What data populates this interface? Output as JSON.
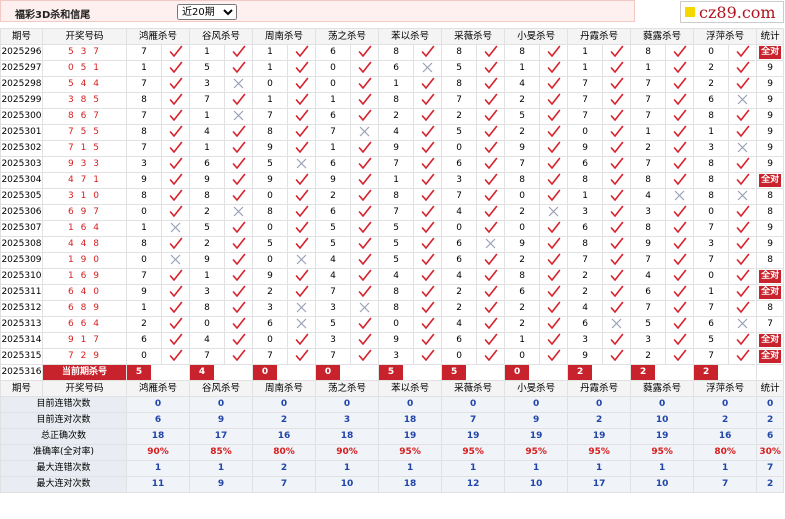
{
  "header": {
    "title": "福彩3D杀和信尾",
    "select_value": "近20期",
    "site": "cz89.com"
  },
  "columns": {
    "period": "期号",
    "code": "开奖号码",
    "stat": "统计",
    "experts": [
      "鸿雁杀号",
      "谷风杀号",
      "周南杀号",
      "荡之杀号",
      "苯以杀号",
      "采薇杀号",
      "小旻杀号",
      "丹霞杀号",
      "蕤露杀号",
      "浮萍杀号"
    ]
  },
  "labels": {
    "all_right": "全对",
    "current": "当前期杀号"
  },
  "rows": [
    {
      "p": "2025296",
      "c": "537",
      "v": [
        [
          7,
          1
        ],
        [
          1,
          1
        ],
        [
          1,
          1
        ],
        [
          6,
          1
        ],
        [
          8,
          1
        ],
        [
          8,
          1
        ],
        [
          8,
          1
        ],
        [
          1,
          1
        ],
        [
          8,
          1
        ],
        [
          0,
          1
        ]
      ],
      "s": "全对"
    },
    {
      "p": "2025297",
      "c": "051",
      "v": [
        [
          1,
          1
        ],
        [
          5,
          1
        ],
        [
          1,
          1
        ],
        [
          0,
          1
        ],
        [
          6,
          0
        ],
        [
          5,
          1
        ],
        [
          1,
          1
        ],
        [
          1,
          1
        ],
        [
          1,
          1
        ],
        [
          2,
          1
        ]
      ],
      "s": "9"
    },
    {
      "p": "2025298",
      "c": "544",
      "v": [
        [
          7,
          1
        ],
        [
          3,
          0
        ],
        [
          0,
          1
        ],
        [
          0,
          1
        ],
        [
          1,
          1
        ],
        [
          8,
          1
        ],
        [
          4,
          1
        ],
        [
          7,
          1
        ],
        [
          7,
          1
        ],
        [
          2,
          1
        ]
      ],
      "s": "9"
    },
    {
      "p": "2025299",
      "c": "385",
      "v": [
        [
          8,
          1
        ],
        [
          7,
          1
        ],
        [
          1,
          1
        ],
        [
          1,
          1
        ],
        [
          8,
          1
        ],
        [
          7,
          1
        ],
        [
          2,
          1
        ],
        [
          7,
          1
        ],
        [
          7,
          1
        ],
        [
          6,
          0
        ]
      ],
      "s": "9"
    },
    {
      "p": "2025300",
      "c": "867",
      "v": [
        [
          7,
          1
        ],
        [
          1,
          0
        ],
        [
          7,
          1
        ],
        [
          6,
          1
        ],
        [
          2,
          1
        ],
        [
          2,
          1
        ],
        [
          5,
          1
        ],
        [
          7,
          1
        ],
        [
          7,
          1
        ],
        [
          8,
          1
        ]
      ],
      "s": "9"
    },
    {
      "p": "2025301",
      "c": "755",
      "v": [
        [
          8,
          1
        ],
        [
          4,
          1
        ],
        [
          8,
          1
        ],
        [
          7,
          0
        ],
        [
          4,
          1
        ],
        [
          5,
          1
        ],
        [
          2,
          1
        ],
        [
          0,
          1
        ],
        [
          1,
          1
        ],
        [
          1,
          1
        ]
      ],
      "s": "9"
    },
    {
      "p": "2025302",
      "c": "715",
      "v": [
        [
          7,
          1
        ],
        [
          1,
          1
        ],
        [
          9,
          1
        ],
        [
          1,
          1
        ],
        [
          9,
          1
        ],
        [
          0,
          1
        ],
        [
          9,
          1
        ],
        [
          9,
          1
        ],
        [
          2,
          1
        ],
        [
          3,
          0
        ]
      ],
      "s": "9"
    },
    {
      "p": "2025303",
      "c": "933",
      "v": [
        [
          3,
          1
        ],
        [
          6,
          1
        ],
        [
          5,
          0
        ],
        [
          6,
          1
        ],
        [
          7,
          1
        ],
        [
          6,
          1
        ],
        [
          7,
          1
        ],
        [
          6,
          1
        ],
        [
          7,
          1
        ],
        [
          8,
          1
        ]
      ],
      "s": "9"
    },
    {
      "p": "2025304",
      "c": "471",
      "v": [
        [
          9,
          1
        ],
        [
          9,
          1
        ],
        [
          9,
          1
        ],
        [
          9,
          1
        ],
        [
          1,
          1
        ],
        [
          3,
          1
        ],
        [
          8,
          1
        ],
        [
          8,
          1
        ],
        [
          8,
          1
        ],
        [
          8,
          1
        ]
      ],
      "s": "全对"
    },
    {
      "p": "2025305",
      "c": "310",
      "v": [
        [
          8,
          1
        ],
        [
          8,
          1
        ],
        [
          0,
          1
        ],
        [
          2,
          1
        ],
        [
          8,
          1
        ],
        [
          7,
          1
        ],
        [
          0,
          1
        ],
        [
          1,
          1
        ],
        [
          4,
          0
        ],
        [
          8,
          0
        ]
      ],
      "s": "8"
    },
    {
      "p": "2025306",
      "c": "697",
      "v": [
        [
          0,
          1
        ],
        [
          2,
          0
        ],
        [
          8,
          1
        ],
        [
          6,
          1
        ],
        [
          7,
          1
        ],
        [
          4,
          1
        ],
        [
          2,
          0
        ],
        [
          3,
          1
        ],
        [
          3,
          1
        ],
        [
          0,
          1
        ]
      ],
      "s": "8"
    },
    {
      "p": "2025307",
      "c": "164",
      "v": [
        [
          1,
          0
        ],
        [
          5,
          1
        ],
        [
          0,
          1
        ],
        [
          5,
          1
        ],
        [
          5,
          1
        ],
        [
          0,
          1
        ],
        [
          0,
          1
        ],
        [
          6,
          1
        ],
        [
          8,
          1
        ],
        [
          7,
          1
        ]
      ],
      "s": "9"
    },
    {
      "p": "2025308",
      "c": "448",
      "v": [
        [
          8,
          1
        ],
        [
          2,
          1
        ],
        [
          5,
          1
        ],
        [
          5,
          1
        ],
        [
          5,
          1
        ],
        [
          6,
          0
        ],
        [
          9,
          1
        ],
        [
          8,
          1
        ],
        [
          9,
          1
        ],
        [
          3,
          1
        ]
      ],
      "s": "9"
    },
    {
      "p": "2025309",
      "c": "190",
      "v": [
        [
          0,
          0
        ],
        [
          9,
          1
        ],
        [
          0,
          0
        ],
        [
          4,
          1
        ],
        [
          5,
          1
        ],
        [
          6,
          1
        ],
        [
          2,
          1
        ],
        [
          7,
          1
        ],
        [
          7,
          1
        ],
        [
          7,
          1
        ]
      ],
      "s": "8"
    },
    {
      "p": "2025310",
      "c": "169",
      "v": [
        [
          7,
          1
        ],
        [
          1,
          1
        ],
        [
          9,
          1
        ],
        [
          4,
          1
        ],
        [
          4,
          1
        ],
        [
          4,
          1
        ],
        [
          8,
          1
        ],
        [
          2,
          1
        ],
        [
          4,
          1
        ],
        [
          0,
          1
        ]
      ],
      "s": "全对"
    },
    {
      "p": "2025311",
      "c": "640",
      "v": [
        [
          9,
          1
        ],
        [
          3,
          1
        ],
        [
          2,
          1
        ],
        [
          7,
          1
        ],
        [
          8,
          1
        ],
        [
          2,
          1
        ],
        [
          6,
          1
        ],
        [
          2,
          1
        ],
        [
          6,
          1
        ],
        [
          1,
          1
        ]
      ],
      "s": "全对"
    },
    {
      "p": "2025312",
      "c": "689",
      "v": [
        [
          1,
          1
        ],
        [
          8,
          1
        ],
        [
          3,
          0
        ],
        [
          3,
          0
        ],
        [
          8,
          1
        ],
        [
          2,
          1
        ],
        [
          2,
          1
        ],
        [
          4,
          1
        ],
        [
          7,
          1
        ],
        [
          7,
          1
        ]
      ],
      "s": "8"
    },
    {
      "p": "2025313",
      "c": "664",
      "v": [
        [
          2,
          1
        ],
        [
          0,
          1
        ],
        [
          6,
          0
        ],
        [
          5,
          1
        ],
        [
          0,
          1
        ],
        [
          4,
          1
        ],
        [
          2,
          1
        ],
        [
          6,
          0
        ],
        [
          5,
          1
        ],
        [
          6,
          0
        ]
      ],
      "s": "7"
    },
    {
      "p": "2025314",
      "c": "917",
      "v": [
        [
          6,
          1
        ],
        [
          4,
          1
        ],
        [
          0,
          1
        ],
        [
          3,
          1
        ],
        [
          9,
          1
        ],
        [
          6,
          1
        ],
        [
          1,
          1
        ],
        [
          3,
          1
        ],
        [
          3,
          1
        ],
        [
          5,
          1
        ]
      ],
      "s": "全对"
    },
    {
      "p": "2025315",
      "c": "729",
      "v": [
        [
          0,
          1
        ],
        [
          7,
          1
        ],
        [
          7,
          1
        ],
        [
          7,
          1
        ],
        [
          3,
          1
        ],
        [
          0,
          1
        ],
        [
          0,
          1
        ],
        [
          9,
          1
        ],
        [
          2,
          1
        ],
        [
          7,
          1
        ]
      ],
      "s": "全对"
    }
  ],
  "current": {
    "p": "2025316",
    "vals": [
      "5",
      "4",
      "0",
      "0",
      "5",
      "5",
      "0",
      "2",
      "2",
      "2"
    ]
  },
  "summary": [
    {
      "label": "目前连错次数",
      "vals": [
        "0",
        "0",
        "0",
        "0",
        "0",
        "0",
        "0",
        "0",
        "0",
        "0"
      ],
      "stat": "0",
      "kind": "v"
    },
    {
      "label": "目前连对次数",
      "vals": [
        "6",
        "9",
        "2",
        "3",
        "18",
        "7",
        "9",
        "2",
        "10",
        "2"
      ],
      "stat": "2",
      "kind": "v"
    },
    {
      "label": "总正确次数",
      "vals": [
        "18",
        "17",
        "16",
        "18",
        "19",
        "19",
        "19",
        "19",
        "19",
        "16"
      ],
      "stat": "6",
      "kind": "v"
    },
    {
      "label": "准确率(全对率)",
      "vals": [
        "90%",
        "85%",
        "80%",
        "90%",
        "95%",
        "95%",
        "95%",
        "95%",
        "95%",
        "80%"
      ],
      "stat": "30%",
      "kind": "pct"
    },
    {
      "label": "最大连错次数",
      "vals": [
        "1",
        "1",
        "2",
        "1",
        "1",
        "1",
        "1",
        "1",
        "1",
        "1"
      ],
      "stat": "7",
      "kind": "v"
    },
    {
      "label": "最大连对次数",
      "vals": [
        "11",
        "9",
        "7",
        "10",
        "18",
        "12",
        "10",
        "17",
        "10",
        "7"
      ],
      "stat": "2",
      "kind": "v"
    }
  ],
  "colors": {
    "accent": "#c8232c",
    "check": "#d8202a",
    "cross": "#9aa0b8",
    "blue": "#2145a8"
  }
}
